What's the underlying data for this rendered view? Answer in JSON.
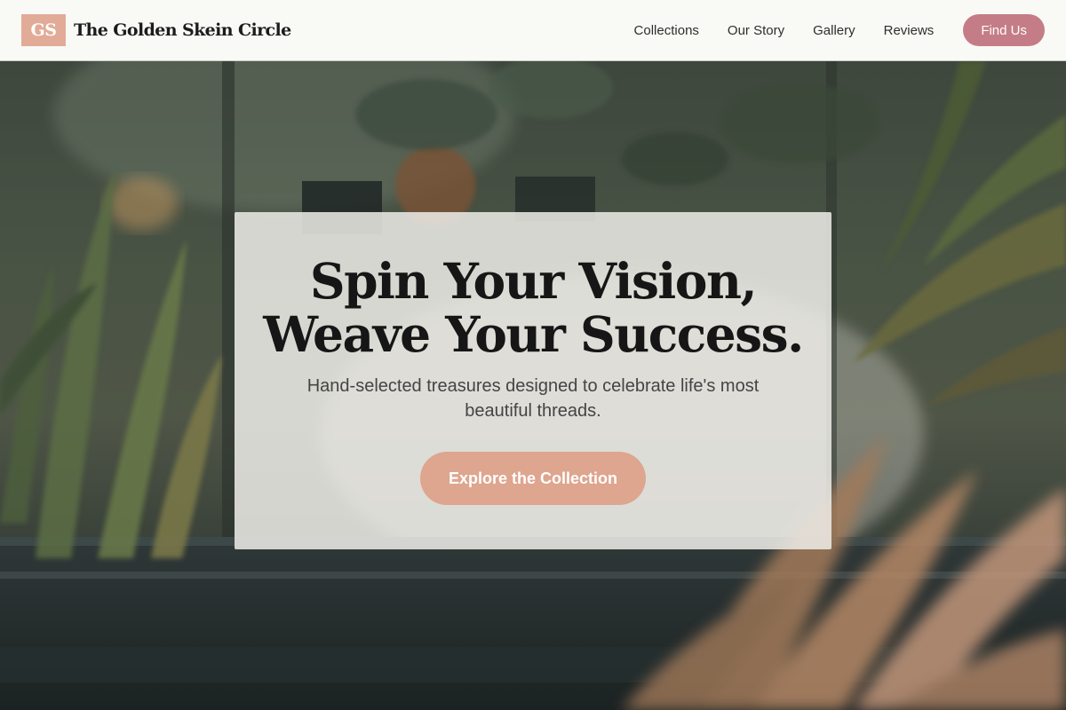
{
  "brand": {
    "logo_initials": "GS",
    "name": "The Golden Skein Circle"
  },
  "nav": {
    "links": [
      "Collections",
      "Our Story",
      "Gallery",
      "Reviews"
    ],
    "cta_label": "Find Us"
  },
  "hero": {
    "headline_line1": "Spin Your Vision,",
    "headline_line2": "Weave Your Success.",
    "subheading": "Hand-selected treasures designed to celebrate life's most beautiful threads.",
    "cta_label": "Explore the Collection"
  },
  "colors": {
    "page_background": "#f9f9f5",
    "logo_mark": "#e2ab97",
    "nav_cta": "#c47d86",
    "hero_cta": "#dea58f",
    "card_overlay": "#eeece8"
  }
}
